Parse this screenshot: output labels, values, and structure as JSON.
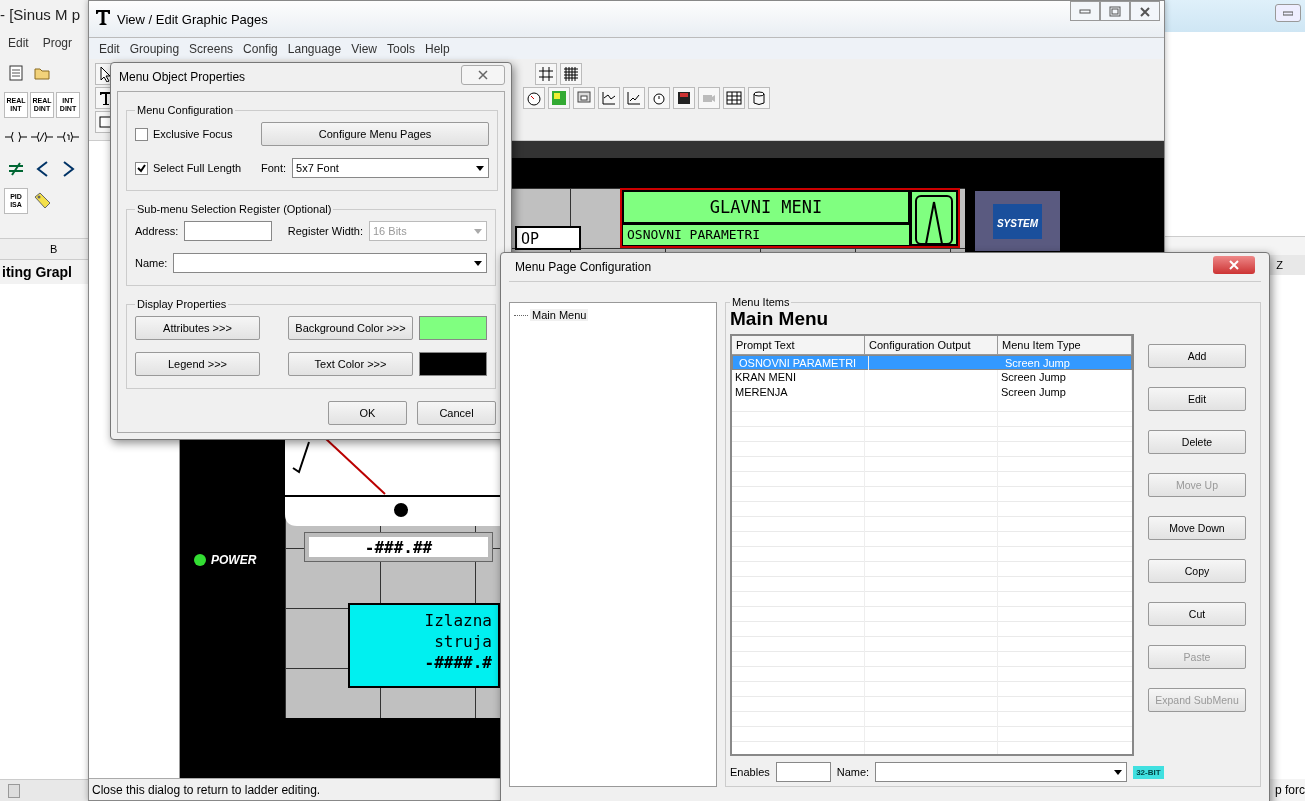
{
  "background_app": {
    "title": "- [Sinus M p",
    "menu": [
      "Edit",
      "Progr"
    ],
    "conversion_buttons": [
      {
        "top": "REAL",
        "bottom": "INT"
      },
      {
        "top": "REAL",
        "bottom": "DINT"
      },
      {
        "top": "INT",
        "bottom": "DINT"
      }
    ],
    "function_button": {
      "top": "PID",
      "bottom": "ISA"
    },
    "column_header": "B",
    "heading": "iting Grapl",
    "right_column_header": "Z",
    "right_status": "p forc"
  },
  "main_window": {
    "title": "View / Edit Graphic Pages",
    "menu": [
      "Edit",
      "Grouping",
      "Screens",
      "Config",
      "Language",
      "View",
      "Tools",
      "Help"
    ],
    "status_bar": "Close this dialog to return to ladder editing."
  },
  "canvas": {
    "menu_object": {
      "title": "GLAVNI MENI",
      "item": "OSNOVNI PARAMETRI"
    },
    "logo_text": "SYSTEM",
    "label_box": "OP",
    "numeric_display": "-###.##",
    "power_indicator": {
      "label": "POWER",
      "on": true
    },
    "cyan_display": [
      "Izlazna",
      "struja",
      "-####.#"
    ]
  },
  "menu_object_dialog": {
    "title": "Menu Object Properties",
    "menu_configuration": {
      "legend": "Menu Configuration",
      "checkboxes": [
        {
          "label": "Exclusive Focus",
          "checked": false
        },
        {
          "label": "Select Full Length",
          "checked": true
        }
      ],
      "configure_button": "Configure Menu Pages",
      "font_label": "Font:",
      "font_value": "5x7 Font"
    },
    "register": {
      "legend": "Sub-menu Selection Register (Optional)",
      "address_label": "Address:",
      "width_label": "Register Width:",
      "width_value": "16 Bits",
      "width_disabled": true,
      "name_label": "Name:"
    },
    "display": {
      "legend": "Display Properties",
      "buttons": [
        "Attributes >>>",
        "Legend >>>"
      ],
      "color_buttons": [
        {
          "label": "Background Color >>>",
          "color": "#80ff80"
        },
        {
          "label": "Text Color >>>",
          "color": "#000000"
        }
      ]
    },
    "buttons": [
      "OK",
      "Cancel"
    ]
  },
  "menu_page_dialog": {
    "title": "Menu Page Configuration",
    "tree": [
      {
        "label": "Main Menu"
      }
    ],
    "group_legend": "Menu Items",
    "heading": "Main Menu",
    "columns": [
      "Prompt Text",
      "Configuration Output",
      "Menu Item Type"
    ],
    "rows": [
      {
        "prompt_text": "OSNOVNI PARAMETRI",
        "menu_item_type": "Screen Jump",
        "selected": true
      },
      {
        "prompt_text": "KRAN MENI",
        "menu_item_type": "Screen Jump",
        "selected": false
      },
      {
        "prompt_text": "MERENJA",
        "menu_item_type": "Screen Jump",
        "selected": false
      }
    ],
    "buttons": [
      {
        "label": "Add",
        "disabled": false
      },
      {
        "label": "Edit",
        "disabled": false
      },
      {
        "label": "Delete",
        "disabled": false
      },
      {
        "label": "Move Up",
        "disabled": true
      },
      {
        "label": "Move Down",
        "disabled": false
      },
      {
        "label": "Copy",
        "disabled": false
      },
      {
        "label": "Cut",
        "disabled": false
      },
      {
        "label": "Paste",
        "disabled": true
      },
      {
        "label": "Expand SubMenu",
        "disabled": true
      }
    ],
    "enables_label": "Enables",
    "name_label": "Name:",
    "badge": "32-BIT"
  }
}
